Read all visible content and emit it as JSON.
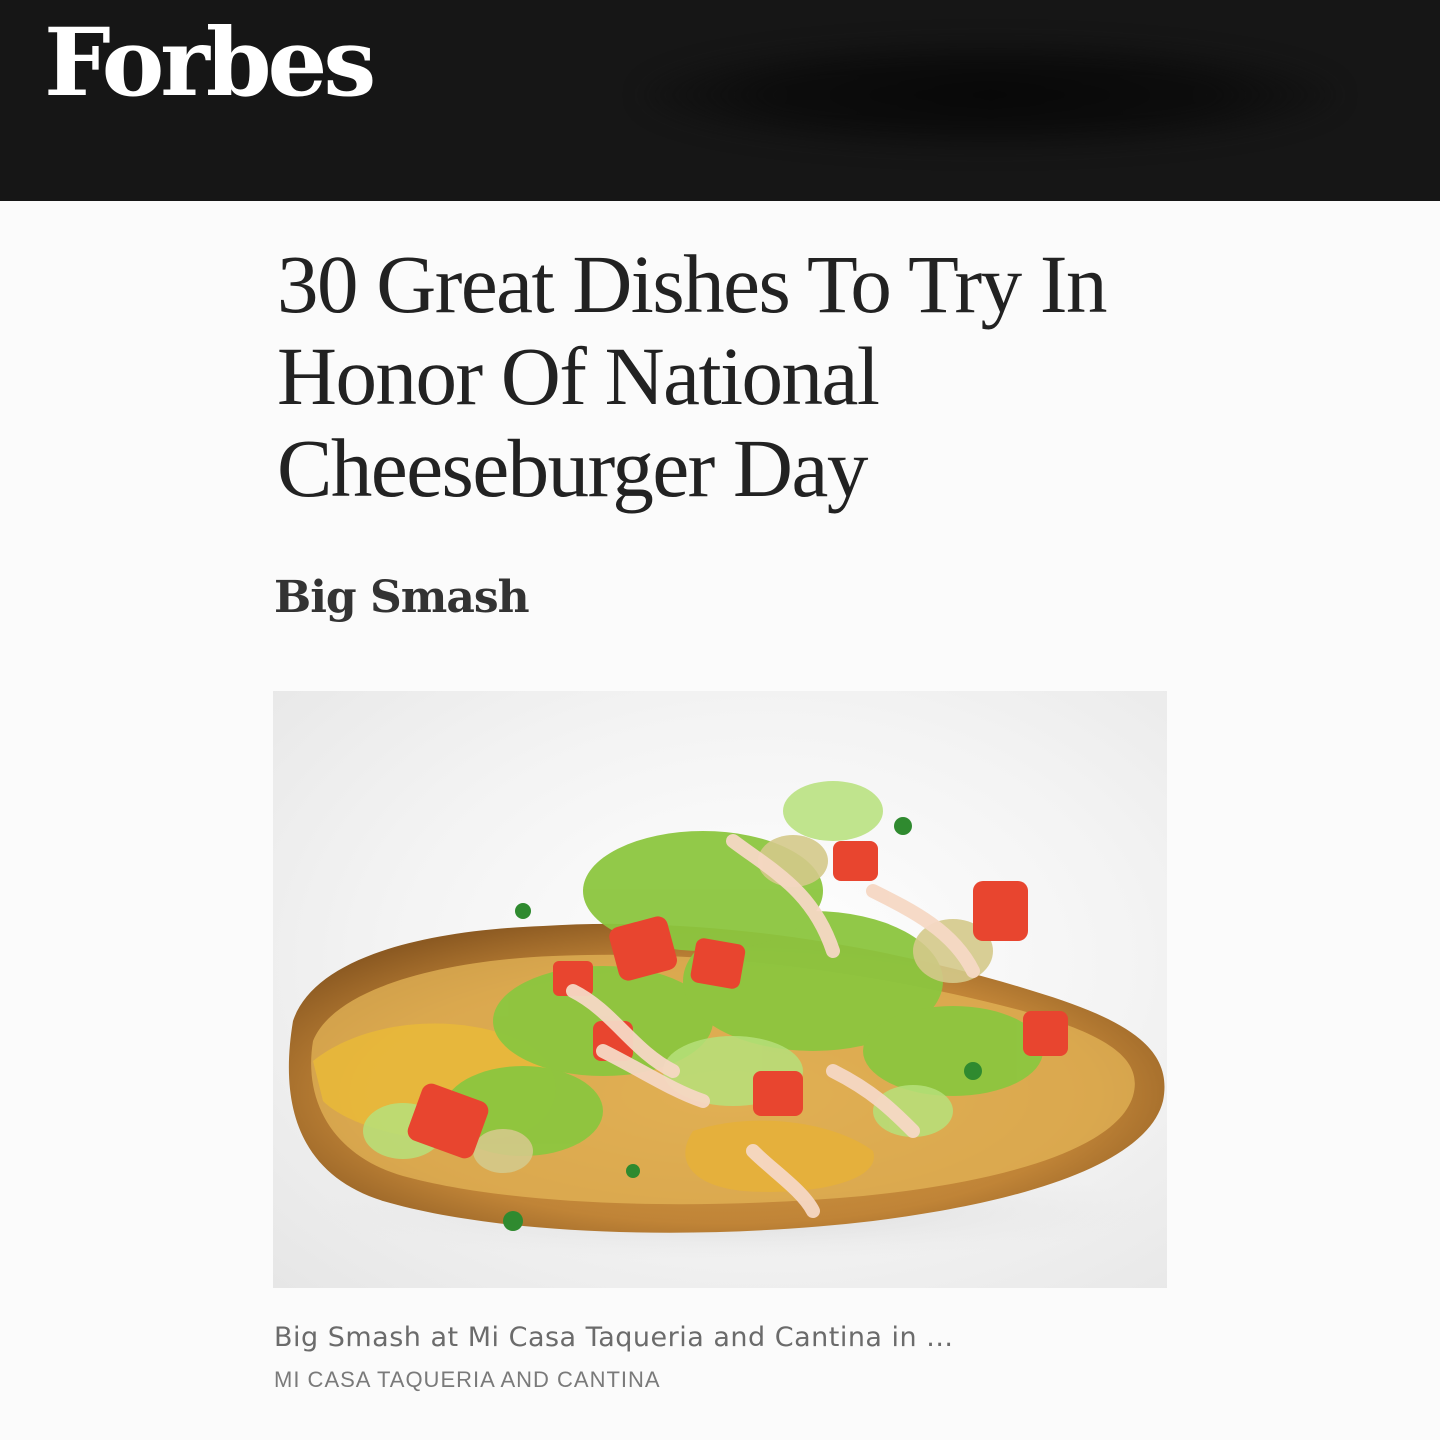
{
  "header": {
    "logo_text": "Forbes"
  },
  "article": {
    "title_lines": [
      "30 Great Dishes To Try In",
      "Honor Of National",
      "Cheeseburger Day"
    ],
    "section_heading": "Big Smash",
    "image": {
      "alt": "Big Smash dish photo",
      "caption": "Big Smash at Mi Casa Taqueria and Cantina in ...",
      "credit": "MI CASA TAQUERIA AND CANTINA"
    }
  },
  "colors": {
    "header_bg": "#161616",
    "logo": "#ffffff",
    "headline": "#222222",
    "caption": "#6b6b6b"
  }
}
